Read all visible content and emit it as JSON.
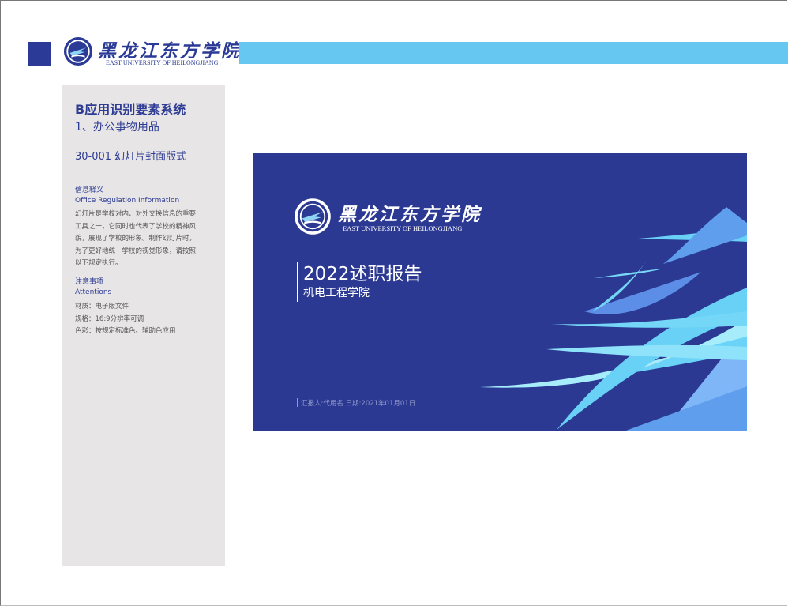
{
  "header": {
    "logo_cn": "黑龙江东方学院",
    "logo_en": "EAST UNIVERSITY OF HEILONGJIANG"
  },
  "sidebar": {
    "section_title": "B应用识别要素系统",
    "subsection_title": "1、办公事物用品",
    "item_code": "30-001 幻灯片封面版式",
    "info": {
      "heading_cn": "信息释义",
      "heading_en": "Office Regulation Information",
      "lines": [
        "幻灯片是学校对内、对外交换信息的重要",
        "工具之一，它同时也代表了学校的精神风",
        "貌，展现了学校的形象。制作幻灯片时，",
        "为了更好地统一学校的视觉形象，请按照",
        "以下规定执行。"
      ]
    },
    "attentions": {
      "heading_cn": "注意事项",
      "heading_en": "Attentions",
      "lines": [
        "材质：电子版文件",
        "规格：16:9分辨率可调",
        "色彩：按规定标准色、辅助色应用"
      ]
    }
  },
  "slide": {
    "logo_cn": "黑龙江东方学院",
    "logo_en": "EAST UNIVERSITY OF HEILONGJIANG",
    "title": "2022述职报告",
    "subtitle": "机电工程学院",
    "footer": "汇报人:代用名  日期:2021年01月01日"
  },
  "colors": {
    "brand_blue": "#2b3992",
    "accent_cyan": "#66c8f0",
    "panel_gray": "#e7e5e6"
  }
}
